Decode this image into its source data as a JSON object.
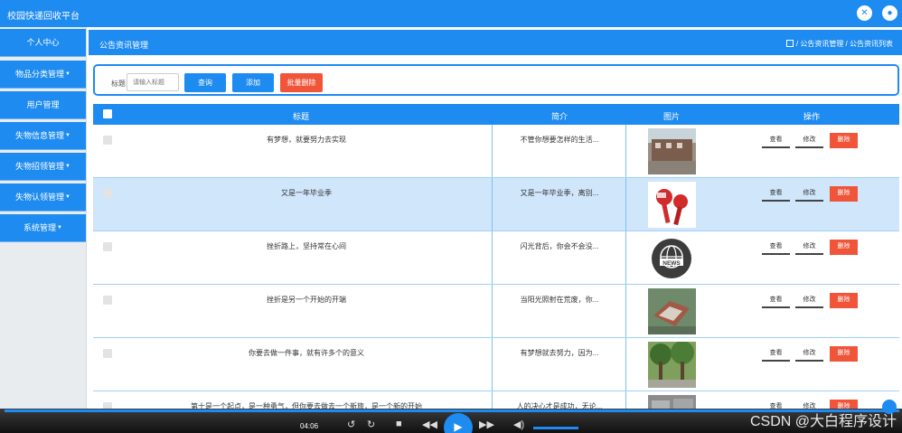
{
  "app": {
    "title": "校园快递回收平台",
    "close_icon": "close-icon",
    "user_icon": "user-icon"
  },
  "sidebar": {
    "items": [
      {
        "label": "个人中心",
        "has_caret": false
      },
      {
        "label": "物品分类管理",
        "has_caret": true
      },
      {
        "label": "用户管理",
        "has_caret": false
      },
      {
        "label": "失物信息管理",
        "has_caret": true
      },
      {
        "label": "失物招领管理",
        "has_caret": true
      },
      {
        "label": "失物认领管理",
        "has_caret": true
      },
      {
        "label": "系统管理",
        "has_caret": true
      }
    ]
  },
  "header": {
    "page_title": "公告资讯管理",
    "breadcrumb": "/ 公告资讯管理 / 公告资讯列表"
  },
  "search": {
    "label": "标题",
    "placeholder": "请输入标题",
    "search_button": "查询",
    "add_button": "添加",
    "batch_delete_button": "批量删除"
  },
  "table": {
    "columns": [
      "标题",
      "简介",
      "图片",
      "操作"
    ],
    "rows": [
      {
        "title": "有梦想，就要努力去实现",
        "desc": "不管你想要怎样的生活...",
        "image": "campus-building"
      },
      {
        "title": "又是一年毕业季",
        "desc": "又是一年毕业季，离别...",
        "image": "microphones"
      },
      {
        "title": "挫折路上，坚持常在心间",
        "desc": "闪光背后，你会不会没...",
        "image": "news-globe"
      },
      {
        "title": "挫折是另一个开始的开端",
        "desc": "当阳光照射在荒废，你...",
        "image": "campus-aerial"
      },
      {
        "title": "你要去做一件事，就有许多个的意义",
        "desc": "有梦想就去努力，因为...",
        "image": "trees"
      },
      {
        "title": "第十是一个起点，是一种勇气，但你要去做去一个新旅，是一个新的开始",
        "desc": "人的决心才是成功，无论...",
        "image": "street"
      }
    ],
    "actions": {
      "view": "查看",
      "edit": "修改",
      "delete": "删除"
    }
  },
  "player": {
    "time": "04:06"
  },
  "watermark": "CSDN @大白程序设计",
  "colors": {
    "primary": "#1e8bf0",
    "danger": "#f0553a",
    "row_highlight": "#cfe6fb"
  }
}
